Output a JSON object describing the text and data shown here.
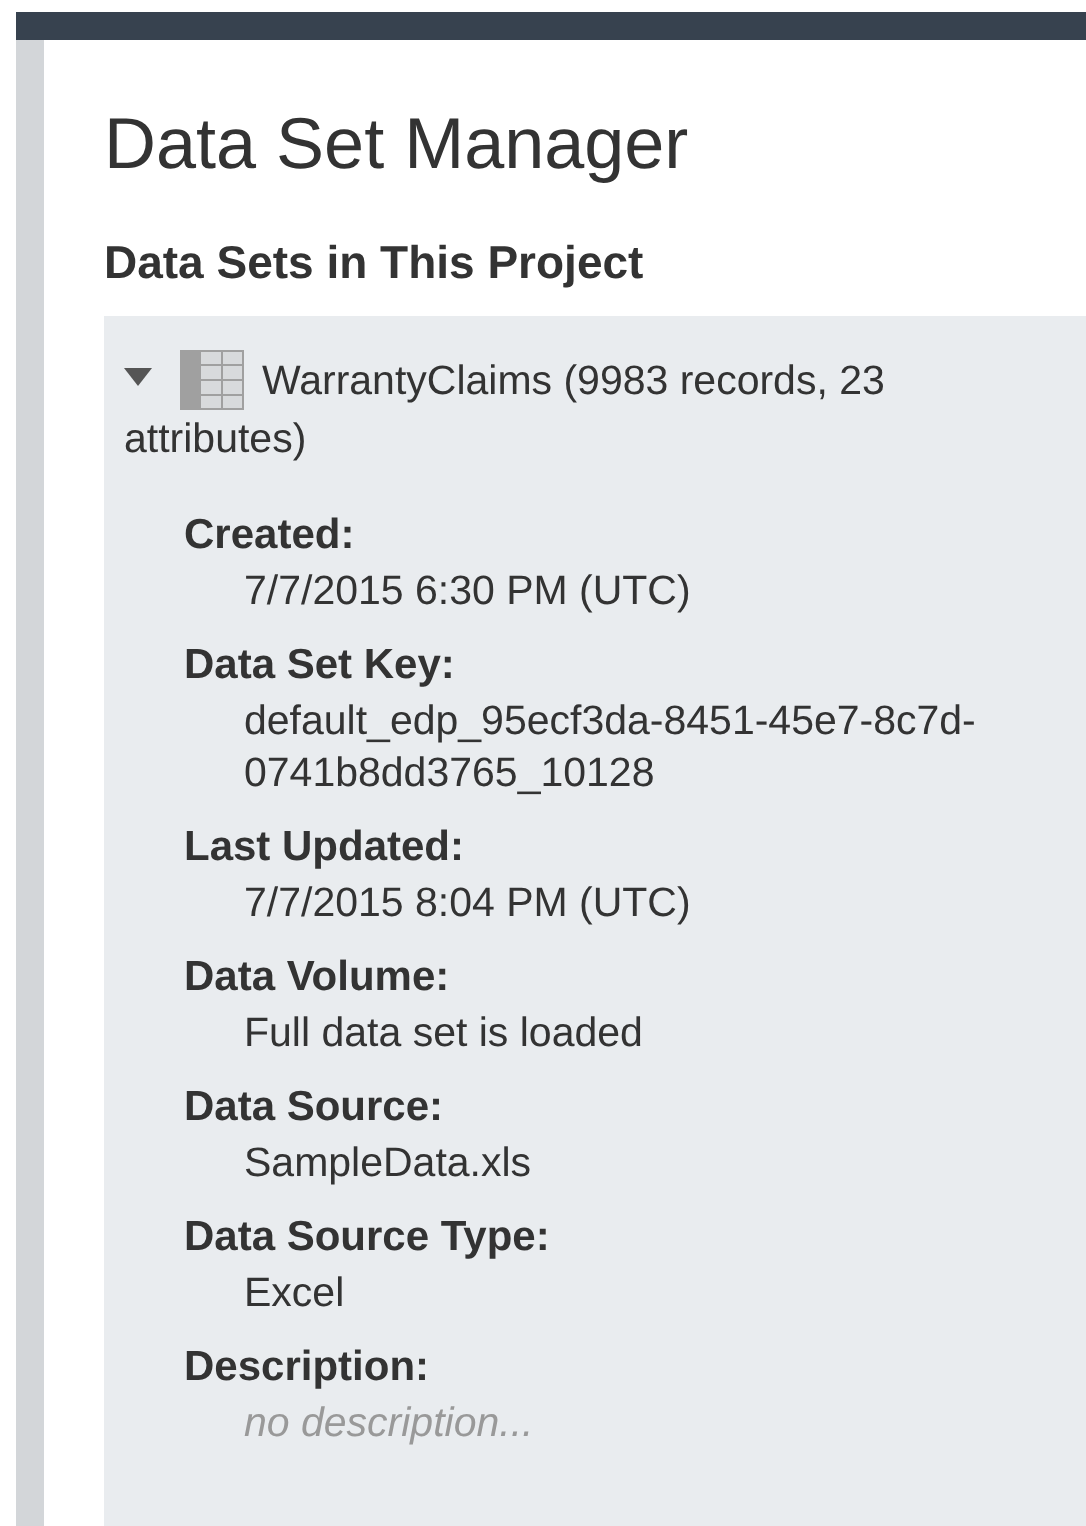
{
  "title": "Data Set Manager",
  "section_title": "Data Sets in This Project",
  "data_sets": [
    {
      "name": "WarrantyClaims (9983 records, 23 attributes)",
      "expanded": true,
      "fields": [
        {
          "label": "Created:",
          "value": "7/7/2015 6:30 PM (UTC)",
          "kind": "text"
        },
        {
          "label": "Data Set Key:",
          "value": "default_edp_95ecf3da-8451-45e7-8c7d-0741b8dd3765_10128",
          "kind": "text"
        },
        {
          "label": "Last Updated:",
          "value": "7/7/2015 8:04 PM (UTC)",
          "kind": "text"
        },
        {
          "label": "Data Volume:",
          "value": "Full data set is loaded",
          "kind": "text"
        },
        {
          "label": "Data Source:",
          "value": "SampleData.xls",
          "kind": "text"
        },
        {
          "label": "Data Source Type:",
          "value": "Excel",
          "kind": "text"
        },
        {
          "label": "Description:",
          "placeholder": "no description...",
          "kind": "field"
        }
      ]
    }
  ]
}
